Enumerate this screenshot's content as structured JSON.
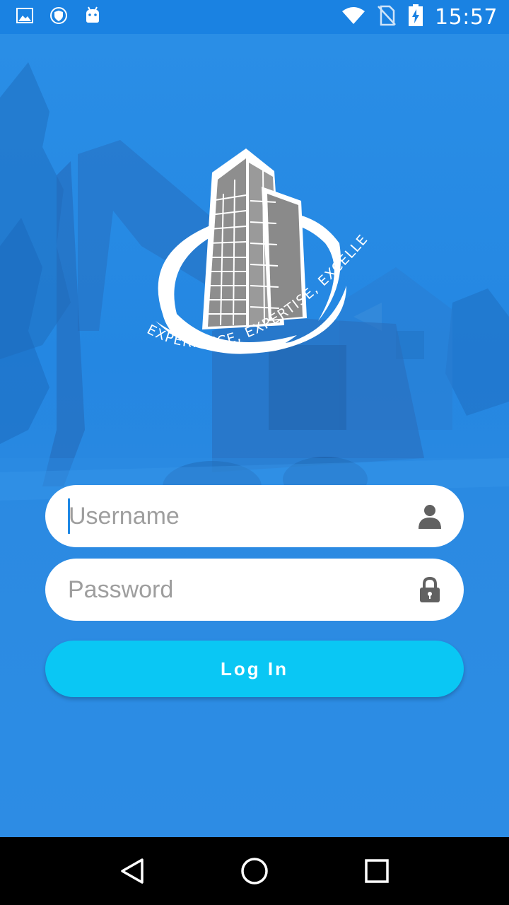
{
  "status_bar": {
    "time": "15:57",
    "icons_left": [
      "image-icon",
      "shield-icon",
      "android-icon"
    ],
    "icons_right": [
      "wifi-icon",
      "no-sim-icon",
      "battery-charging-icon"
    ]
  },
  "logo": {
    "tagline": "EXPERIENCE, EXPERTISE, EXCELLENCE"
  },
  "login_form": {
    "username_placeholder": "Username",
    "username_value": "",
    "password_placeholder": "Password",
    "password_value": "",
    "login_label": "Log In"
  },
  "nav_bar": {
    "buttons": [
      "back-icon",
      "home-icon",
      "recents-icon"
    ]
  },
  "colors": {
    "status_bar": "#1a82e2",
    "background": "#2a8be4",
    "button": "#0ac7f4",
    "field": "#ffffff"
  }
}
